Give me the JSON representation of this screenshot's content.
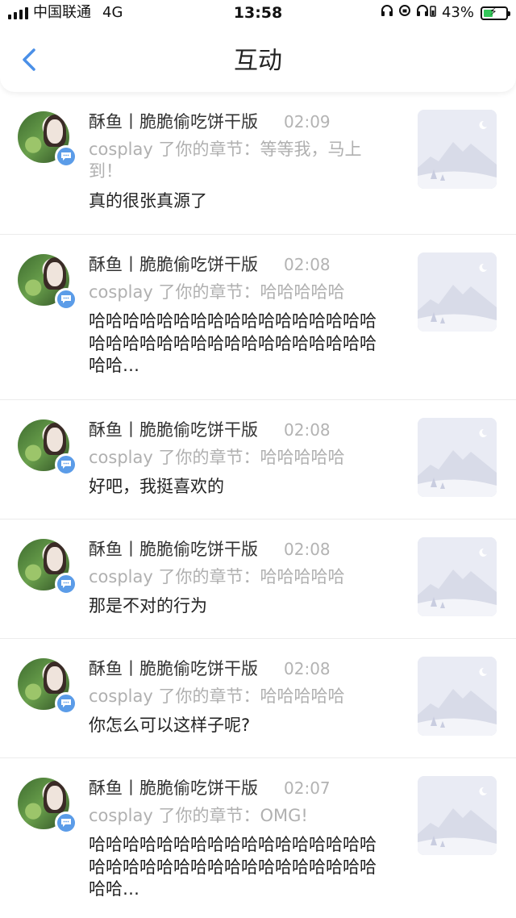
{
  "status_bar": {
    "carrier": "中国联通",
    "network": "4G",
    "time": "13:58",
    "battery_percent_label": "43%",
    "battery_level": 0.43,
    "icons": [
      "signal-icon",
      "headphones-icon",
      "orientation-lock-icon",
      "headphones-battery-icon",
      "battery-icon"
    ]
  },
  "nav": {
    "title": "互动",
    "back_icon": "chevron-left-icon",
    "accent_color": "#4a8fe7"
  },
  "notifications": [
    {
      "user": "酥鱼丨脆脆偷吃饼干版",
      "time": "02:09",
      "subtitle": "cosplay 了你的章节：等等我，马上到！",
      "body": "真的很张真源了"
    },
    {
      "user": "酥鱼丨脆脆偷吃饼干版",
      "time": "02:08",
      "subtitle": "cosplay 了你的章节：哈哈哈哈哈",
      "body": "哈哈哈哈哈哈哈哈哈哈哈哈哈哈哈哈哈哈哈哈哈哈哈哈哈哈哈哈哈哈哈哈哈哈哈哈…"
    },
    {
      "user": "酥鱼丨脆脆偷吃饼干版",
      "time": "02:08",
      "subtitle": "cosplay 了你的章节：哈哈哈哈哈",
      "body": "好吧，我挺喜欢的"
    },
    {
      "user": "酥鱼丨脆脆偷吃饼干版",
      "time": "02:08",
      "subtitle": "cosplay 了你的章节：哈哈哈哈哈",
      "body": "那是不对的行为"
    },
    {
      "user": "酥鱼丨脆脆偷吃饼干版",
      "time": "02:08",
      "subtitle": "cosplay 了你的章节：哈哈哈哈哈",
      "body": "你怎么可以这样子呢?"
    },
    {
      "user": "酥鱼丨脆脆偷吃饼干版",
      "time": "02:07",
      "subtitle": "cosplay 了你的章节：OMG!",
      "body": "哈哈哈哈哈哈哈哈哈哈哈哈哈哈哈哈哈哈哈哈哈哈哈哈哈哈哈哈哈哈哈哈哈哈哈哈…"
    }
  ],
  "colors": {
    "comment_badge": "#5b9ce8",
    "placeholder_bg": "#e9ebf4",
    "secondary_text": "#b0b0b0"
  }
}
